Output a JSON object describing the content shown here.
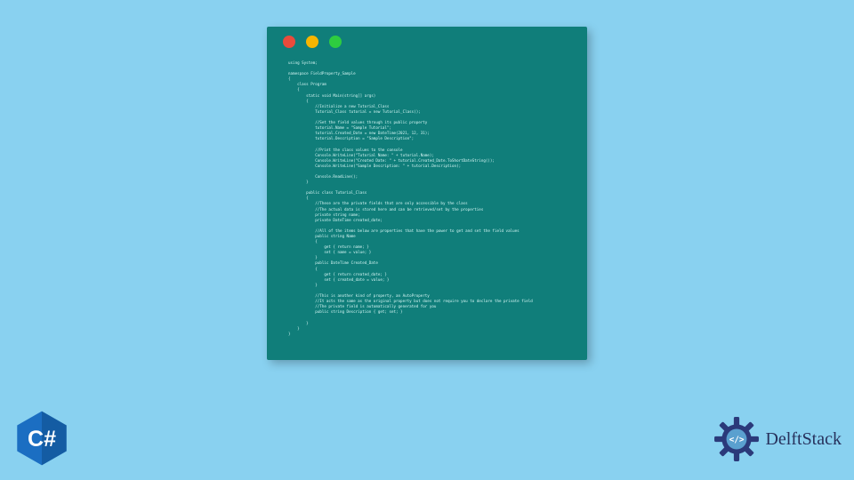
{
  "window": {
    "dots": [
      "red",
      "yellow",
      "green"
    ]
  },
  "code": "using System;\n\nnamespace FieldProperty_Sample\n{\n    class Program\n    {\n        static void Main(string[] args)\n        {\n            //Initialize a new Tutorial_Class\n            Tutorial_Class tutorial = new Tutorial_Class();\n\n            //Set the field values through its public property\n            tutorial.Name = \"Sample Tutorial\";\n            tutorial.Created_Date = new DateTime(2021, 12, 31);\n            tutorial.Description = \"Sample Description\";\n\n            //Print the class values to the console\n            Console.WriteLine(\"Tutorial Name: \" + tutorial.Name);\n            Console.WriteLine(\"Created Date: \" + tutorial.Created_Date.ToShortDateString());\n            Console.WriteLine(\"Sample Description: \" + tutorial.Description);\n\n            Console.ReadLine();\n        }\n\n        public class Tutorial_Class\n        {\n            //These are the private fields that are only accessible by the class\n            //The actual data is stored here and can be retrieved/set by the properties\n            private string name;\n            private DateTime created_date;\n\n            //All of the items below are properties that have the power to get and set the field values\n            public string Name\n            {\n                get { return name; }\n                set { name = value; }\n            }\n            public DateTime Created_Date\n            {\n                get { return created_date; }\n                set { created_date = value; }\n            }\n\n            //This is another kind of property, an AutoProperty\n            //It acts the same as the original property but does not require you to declare the private field\n            //The private field is automatically generated for you\n            public string Description { get; set; }\n\n        }\n    }\n}",
  "badges": {
    "csharp_label": "C#",
    "brand_text": "DelftStack"
  },
  "colors": {
    "background": "#89d1f0",
    "window": "#107e7a",
    "code_text": "#d7f7f5",
    "csharp_primary": "#1b6ec2",
    "csharp_dark": "#0e4f8a",
    "brand_gear": "#2b3a7a",
    "brand_inner": "#5aa0cf",
    "brand_text": "#27315c"
  }
}
